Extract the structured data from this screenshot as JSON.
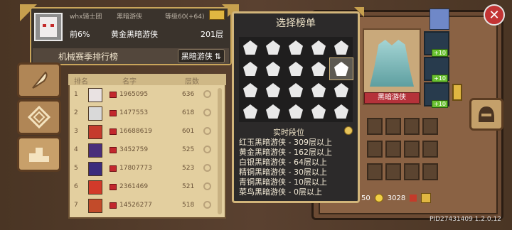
{
  "player": {
    "name": "whx骑士团",
    "hero": "黑暗游侠",
    "level": "等级60(+64)",
    "percentile": "前6%",
    "tier_title": "黄金黑暗游侠",
    "floors": "201层"
  },
  "season": {
    "title": "机械赛季排行榜",
    "selector_label": "黑暗游侠"
  },
  "table": {
    "headers": {
      "rank": "排名",
      "name": "名字",
      "floors": "层数"
    },
    "rows": [
      {
        "rank": "1",
        "name": "1965095",
        "floors": "636",
        "avatar_color": "#e9e2e2"
      },
      {
        "rank": "2",
        "name": "1477553",
        "floors": "618",
        "avatar_color": "#d9d9d9"
      },
      {
        "rank": "3",
        "name": "16688619",
        "floors": "601",
        "avatar_color": "#c53b2c"
      },
      {
        "rank": "4",
        "name": "3452759",
        "floors": "525",
        "avatar_color": "#4a2f7a"
      },
      {
        "rank": "5",
        "name": "17807773",
        "floors": "523",
        "avatar_color": "#3b2c7c"
      },
      {
        "rank": "6",
        "name": "2361469",
        "floors": "521",
        "avatar_color": "#d23a2a"
      },
      {
        "rank": "7",
        "name": "14526277",
        "floors": "518",
        "avatar_color": "#c24b2a"
      }
    ]
  },
  "popup": {
    "title": "选择榜单",
    "realtime_title": "实时段位",
    "tiers": [
      "红玉黑暗游侠 - 309层以上",
      "黄金黑暗游侠 - 162层以上",
      "白银黑暗游侠 - 64层以上",
      "精铜黑暗游侠 - 30层以上",
      "青铜黑暗游侠 - 10层以上",
      "菜鸟黑暗游侠 - 0层以上"
    ]
  },
  "hero_panel": {
    "name": "黑暗游侠"
  },
  "equipment": {
    "plus_labels": [
      "+10",
      "+10",
      "+10"
    ]
  },
  "currency": {
    "gems": "50",
    "gold": "3028"
  },
  "build": {
    "pid": "PID27431409 1.2.0.12"
  },
  "colors": {
    "accent": "#d2b57a",
    "table_bg": "#e3cf9f",
    "close": "#c23434"
  }
}
